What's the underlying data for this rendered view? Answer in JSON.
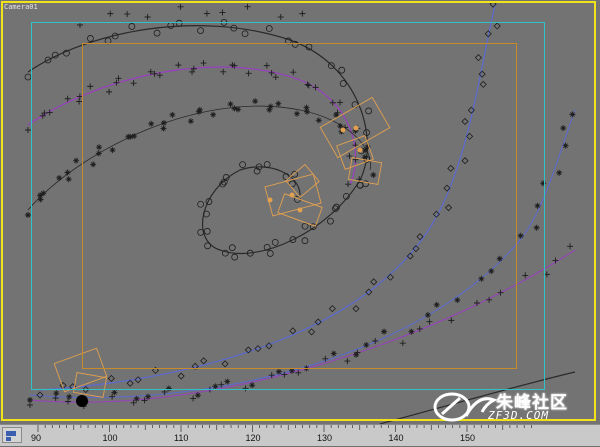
{
  "viewport": {
    "label": "Camera01",
    "colors": {
      "background": "#737373",
      "frame_border": "#f0e31a",
      "safe_frame_outer": "#2fc3c8",
      "safe_frame_inner": "#c88b2a",
      "curve_dark": "#2a2a2a",
      "curve_purple": "#9a3fc2",
      "curve_blue": "#5a6ad0",
      "bones": "#e0a050"
    }
  },
  "watermark": {
    "main_text": "朱峰社区",
    "sub_text": "ZF3D.COM"
  },
  "timeline": {
    "ticks": [
      "90",
      "100",
      "110",
      "120",
      "130",
      "140",
      "150"
    ]
  }
}
